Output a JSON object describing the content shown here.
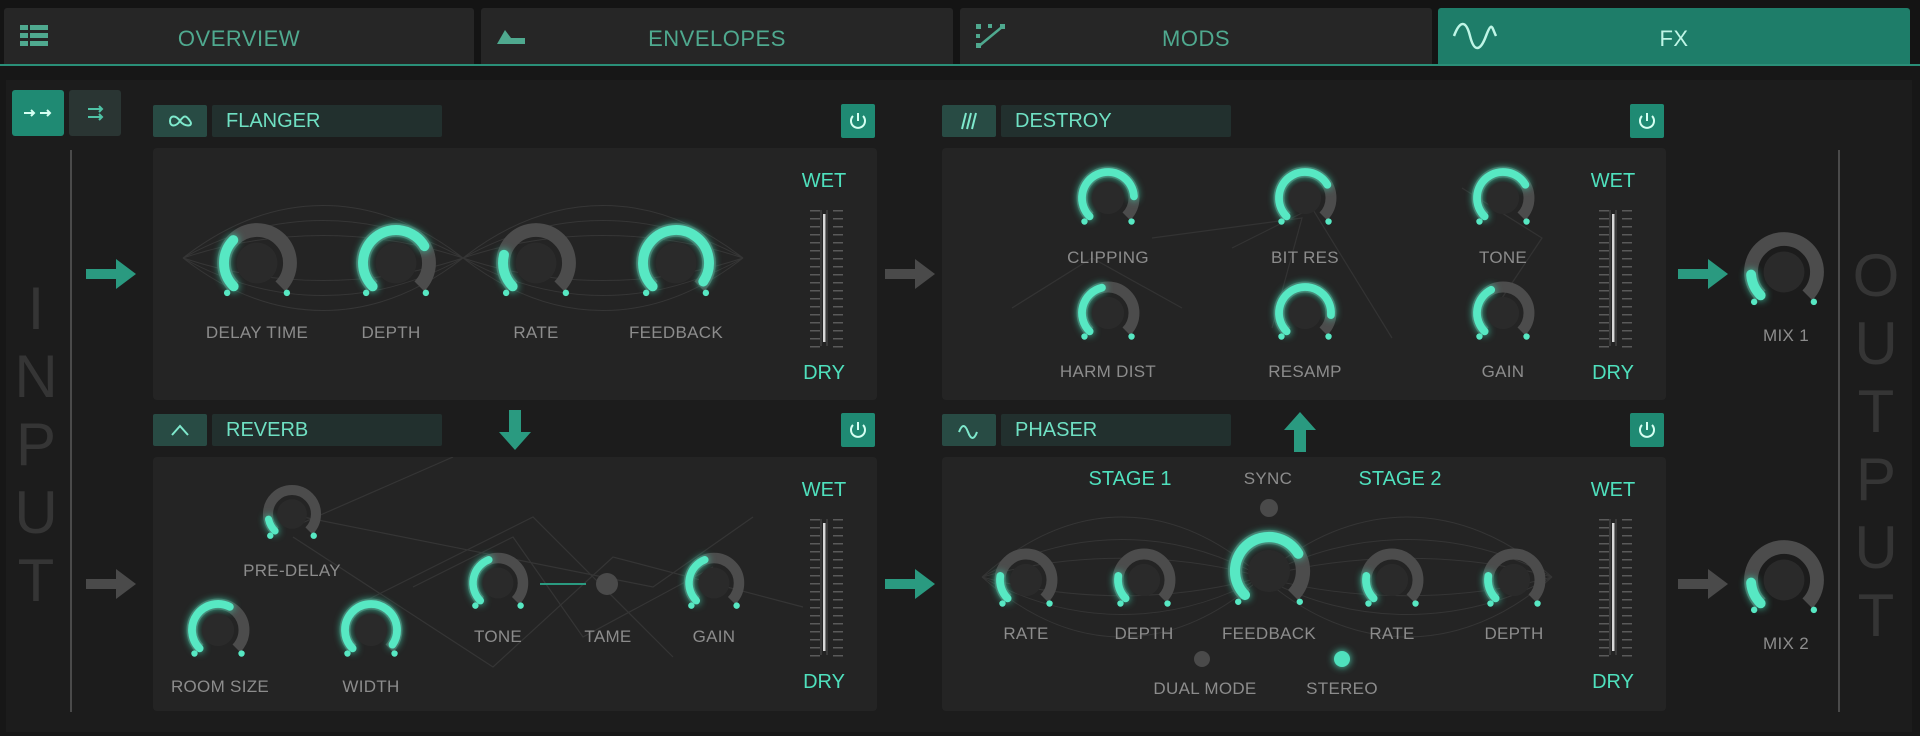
{
  "tabs": [
    {
      "label": "OVERVIEW",
      "icon": "grid-icon"
    },
    {
      "label": "ENVELOPES",
      "icon": "envelope-shape-icon"
    },
    {
      "label": "MODS",
      "icon": "modulation-icon"
    },
    {
      "label": "FX",
      "icon": "sine-wave-icon",
      "active": true
    }
  ],
  "side": {
    "input": [
      "I",
      "N",
      "P",
      "U",
      "T"
    ],
    "output": [
      "O",
      "U",
      "T",
      "P",
      "U",
      "T"
    ]
  },
  "flanger": {
    "name": "FLANGER",
    "icon": "infinity-icon",
    "wet": "WET",
    "dry": "DRY",
    "knobs": [
      "DELAY TIME",
      "DEPTH",
      "RATE",
      "FEEDBACK"
    ]
  },
  "reverb": {
    "name": "REVERB",
    "icon": "reverb-icon",
    "wet": "WET",
    "dry": "DRY",
    "pre_delay": "PRE-DELAY",
    "room_size": "ROOM SIZE",
    "width": "WIDTH",
    "tone": "TONE",
    "tame": "TAME",
    "gain": "GAIN"
  },
  "destroy": {
    "name": "DESTROY",
    "icon": "distortion-icon",
    "wet": "WET",
    "dry": "DRY",
    "knobs": [
      "CLIPPING",
      "BIT RES",
      "TONE",
      "HARM DIST",
      "RESAMP",
      "GAIN"
    ]
  },
  "phaser": {
    "name": "PHASER",
    "icon": "phaser-wave-icon",
    "wet": "WET",
    "dry": "DRY",
    "stage1": "STAGE 1",
    "stage2": "STAGE 2",
    "sync": "SYNC",
    "knobs": [
      "RATE",
      "DEPTH",
      "FEEDBACK",
      "RATE",
      "DEPTH"
    ],
    "dual_mode": "DUAL MODE",
    "stereo": "STEREO"
  },
  "mix": {
    "mix1": "MIX 1",
    "mix2": "MIX 2"
  },
  "colors": {
    "accent": "#4fe0bd",
    "tab_active": "#1e7d69",
    "panel": "#242424",
    "arrow": "#2a9a80"
  }
}
